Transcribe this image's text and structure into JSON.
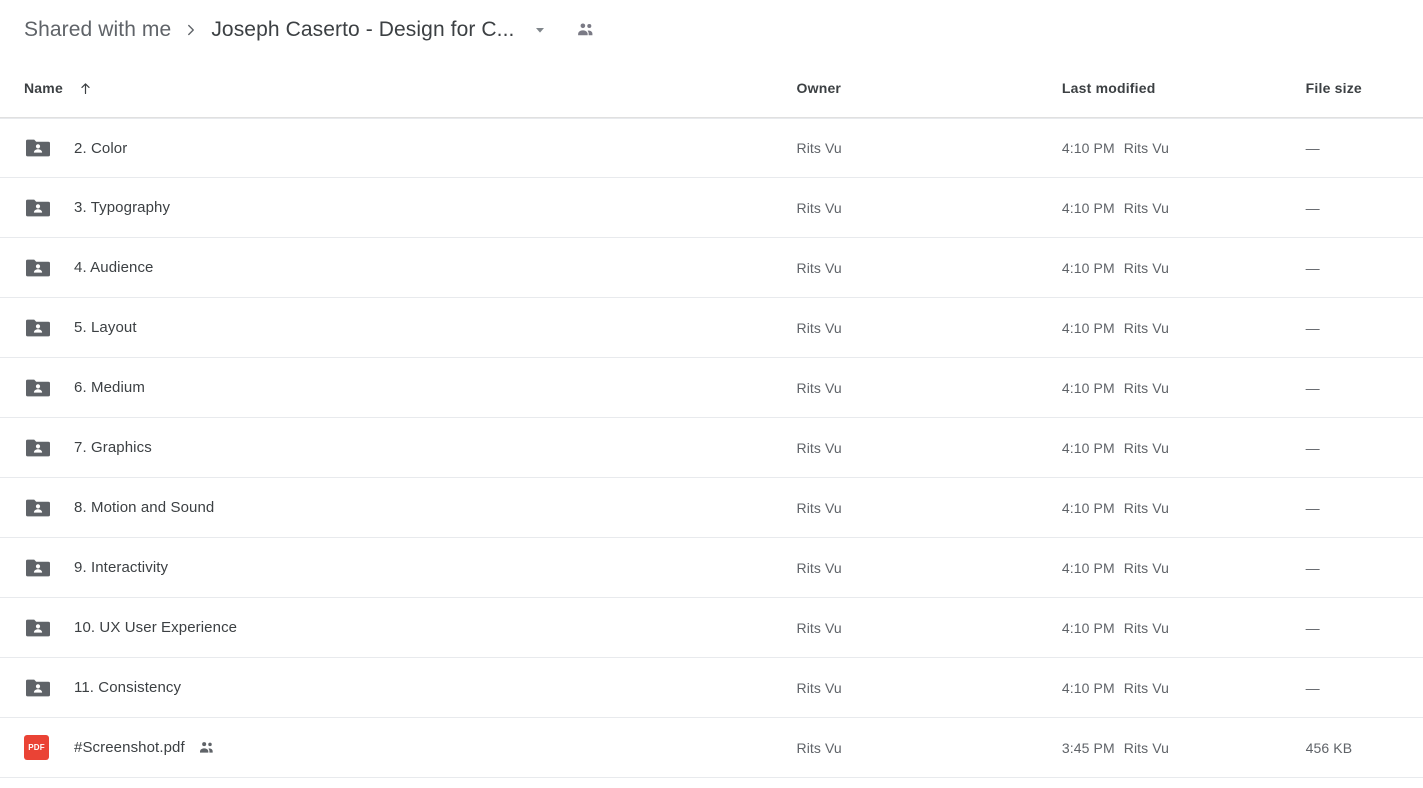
{
  "breadcrumb": {
    "parent": "Shared with me",
    "separator": "chevron-right-icon",
    "current": "Joseph Caserto - Design for C...",
    "caret": "chevron-down-icon",
    "shared_icon": "people-shared-icon"
  },
  "table": {
    "headers": {
      "name": "Name",
      "sort_indicator": "arrow-up-icon",
      "owner": "Owner",
      "modified": "Last modified",
      "size": "File size"
    },
    "rows": [
      {
        "icon": "shared-folder-icon",
        "name": "2. Color",
        "shared": false,
        "owner": "Rits Vu",
        "modified_time": "4:10 PM",
        "modified_by": "Rits Vu",
        "size": "—"
      },
      {
        "icon": "shared-folder-icon",
        "name": "3. Typography",
        "shared": false,
        "owner": "Rits Vu",
        "modified_time": "4:10 PM",
        "modified_by": "Rits Vu",
        "size": "—"
      },
      {
        "icon": "shared-folder-icon",
        "name": "4. Audience",
        "shared": false,
        "owner": "Rits Vu",
        "modified_time": "4:10 PM",
        "modified_by": "Rits Vu",
        "size": "—"
      },
      {
        "icon": "shared-folder-icon",
        "name": "5. Layout",
        "shared": false,
        "owner": "Rits Vu",
        "modified_time": "4:10 PM",
        "modified_by": "Rits Vu",
        "size": "—"
      },
      {
        "icon": "shared-folder-icon",
        "name": "6. Medium",
        "shared": false,
        "owner": "Rits Vu",
        "modified_time": "4:10 PM",
        "modified_by": "Rits Vu",
        "size": "—"
      },
      {
        "icon": "shared-folder-icon",
        "name": "7. Graphics",
        "shared": false,
        "owner": "Rits Vu",
        "modified_time": "4:10 PM",
        "modified_by": "Rits Vu",
        "size": "—"
      },
      {
        "icon": "shared-folder-icon",
        "name": "8. Motion and Sound",
        "shared": false,
        "owner": "Rits Vu",
        "modified_time": "4:10 PM",
        "modified_by": "Rits Vu",
        "size": "—"
      },
      {
        "icon": "shared-folder-icon",
        "name": "9. Interactivity",
        "shared": false,
        "owner": "Rits Vu",
        "modified_time": "4:10 PM",
        "modified_by": "Rits Vu",
        "size": "—"
      },
      {
        "icon": "shared-folder-icon",
        "name": "10. UX User Experience",
        "shared": false,
        "owner": "Rits Vu",
        "modified_time": "4:10 PM",
        "modified_by": "Rits Vu",
        "size": "—"
      },
      {
        "icon": "shared-folder-icon",
        "name": "11. Consistency",
        "shared": false,
        "owner": "Rits Vu",
        "modified_time": "4:10 PM",
        "modified_by": "Rits Vu",
        "size": "—"
      },
      {
        "icon": "pdf-file-icon",
        "name": "#Screenshot.pdf",
        "shared": true,
        "owner": "Rits Vu",
        "modified_time": "3:45 PM",
        "modified_by": "Rits Vu",
        "size": "456 KB",
        "badge_label": "PDF"
      }
    ]
  },
  "colors": {
    "text_primary": "#3c4043",
    "text_secondary": "#5f6368",
    "folder_icon": "#5f6368",
    "pdf_red": "#ea4335",
    "divider": "#e8eaed"
  }
}
